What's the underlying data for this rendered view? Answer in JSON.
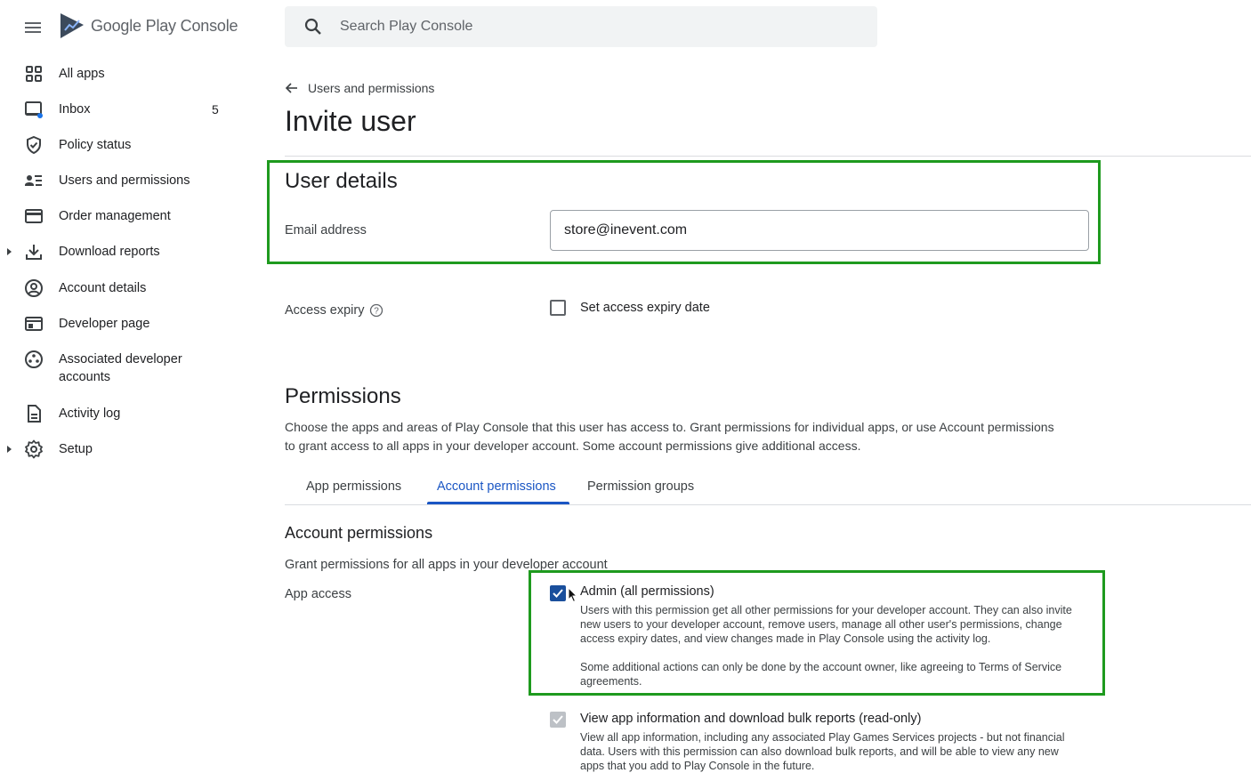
{
  "app": {
    "name": "Google Play Console"
  },
  "search": {
    "placeholder": "Search Play Console"
  },
  "sidebar": {
    "items": [
      {
        "label": "All apps",
        "icon": "grid-icon"
      },
      {
        "label": "Inbox",
        "icon": "inbox-icon",
        "badge": "5"
      },
      {
        "label": "Policy status",
        "icon": "shield-check-icon"
      },
      {
        "label": "Users and permissions",
        "icon": "users-list-icon"
      },
      {
        "label": "Order management",
        "icon": "credit-card-icon"
      },
      {
        "label": "Download reports",
        "icon": "download-icon"
      },
      {
        "label": "Account details",
        "icon": "account-circle-icon"
      },
      {
        "label": "Developer page",
        "icon": "web-page-icon"
      },
      {
        "label": "Associated developer",
        "label2": "accounts",
        "icon": "linked-accounts-icon"
      },
      {
        "label": "Activity log",
        "icon": "document-icon"
      },
      {
        "label": "Setup",
        "icon": "gear-icon"
      }
    ]
  },
  "breadcrumb": {
    "back_label": "Users and permissions"
  },
  "page": {
    "title": "Invite user"
  },
  "user_details": {
    "heading": "User details",
    "email_label": "Email address",
    "email_value": "store@inevent.com",
    "access_expiry_label": "Access expiry",
    "access_expiry_checkbox_label": "Set access expiry date"
  },
  "permissions": {
    "heading": "Permissions",
    "description_line1": "Choose the apps and areas of Play Console that this user has access to. Grant permissions for individual apps, or use Account permissions",
    "description_line2": "to grant access to all apps in your developer account. Some account permissions give additional access.",
    "tabs": [
      {
        "label": "App permissions",
        "active": false
      },
      {
        "label": "Account permissions",
        "active": true
      },
      {
        "label": "Permission groups",
        "active": false
      }
    ]
  },
  "account_permissions": {
    "heading": "Account permissions",
    "subtext": "Grant permissions for all apps in your developer account",
    "app_access_label": "App access",
    "items": [
      {
        "title": "Admin (all permissions)",
        "checked": true,
        "desc_lines": [
          "Users with this permission get all other permissions for your developer account. They can also invite",
          "new users to your developer account, remove users, manage all other user's permissions, change",
          "access expiry dates, and view changes made in Play Console using the activity log."
        ],
        "note_lines": [
          "Some additional actions can only be done by the account owner, like agreeing to Terms of Service",
          "agreements."
        ]
      },
      {
        "title": "View app information and download bulk reports (read-only)",
        "checked": true,
        "disabled": true,
        "desc_lines": [
          "View all app information, including any associated Play Games Services projects - but not financial",
          "data. Users with this permission can also download bulk reports, and will be able to view any new",
          "apps that you add to Play Console in the future."
        ]
      }
    ]
  },
  "colors": {
    "highlight": "#1e9a1e",
    "accent": "#1a56c4",
    "checkbox": "#1a4f9c"
  }
}
